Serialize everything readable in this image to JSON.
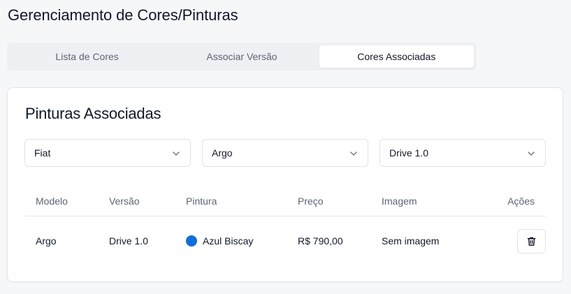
{
  "page": {
    "title": "Gerenciamento de Cores/Pinturas"
  },
  "tabs": [
    {
      "label": "Lista de Cores",
      "active": false
    },
    {
      "label": "Associar Versão",
      "active": false
    },
    {
      "label": "Cores Associadas",
      "active": true
    }
  ],
  "card": {
    "title": "Pinturas Associadas"
  },
  "filters": {
    "marca": {
      "value": "Fiat",
      "icon": "chevron-down-icon"
    },
    "modelo": {
      "value": "Argo",
      "icon": "chevron-down-icon"
    },
    "versao": {
      "value": "Drive 1.0",
      "icon": "chevron-down-icon"
    }
  },
  "table": {
    "headers": {
      "modelo": "Modelo",
      "versao": "Versão",
      "pintura": "Pintura",
      "preco": "Preço",
      "imagem": "Imagem",
      "acoes": "Ações"
    },
    "rows": [
      {
        "modelo": "Argo",
        "versao": "Drive 1.0",
        "pintura": "Azul Biscay",
        "cor": "#0f6fd6",
        "preco": "R$ 790,00",
        "imagem": "Sem imagem",
        "acao_icon": "trash-icon"
      }
    ]
  }
}
